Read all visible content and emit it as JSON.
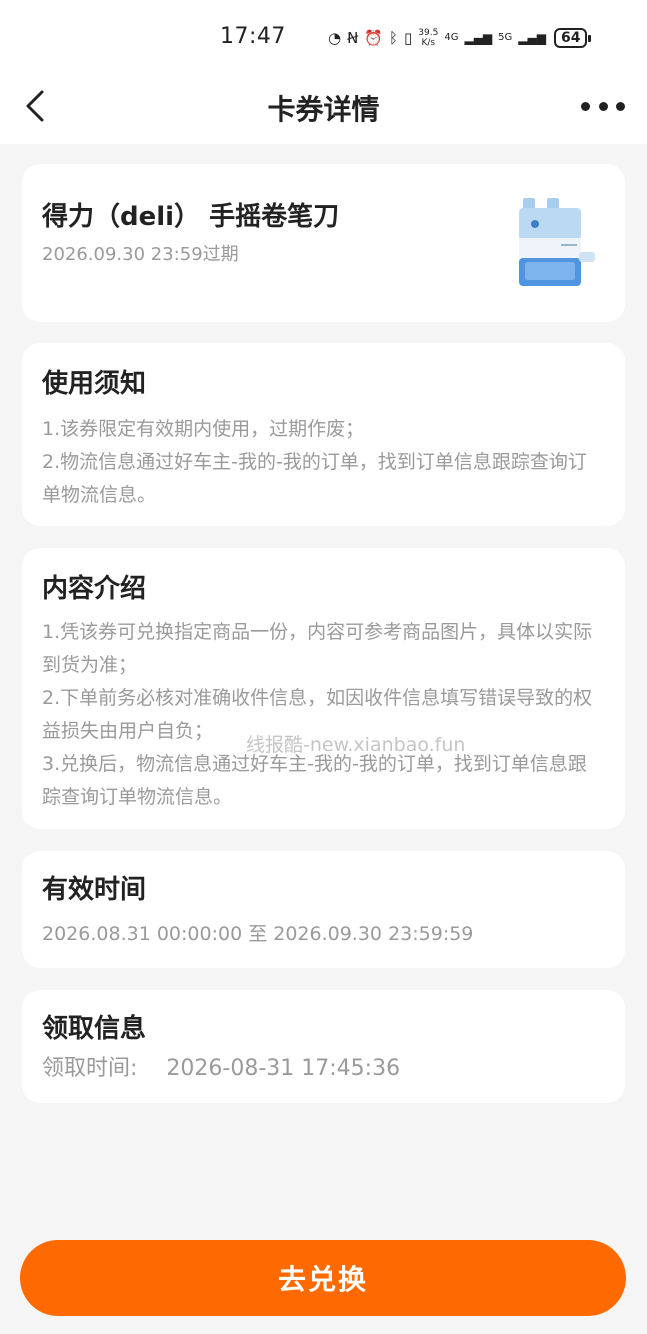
{
  "status_bar": {
    "time": "17:47",
    "net_speed_value": "39.5",
    "net_speed_unit": "K/s",
    "signal_4g": "4G",
    "signal_5g": "5G",
    "battery": "64"
  },
  "nav": {
    "title": "卡券详情"
  },
  "product": {
    "name": "得力（deli） 手摇卷笔刀",
    "expire": "2026.09.30 23:59过期"
  },
  "usage": {
    "title": "使用须知",
    "lines": [
      "1.该券限定有效期内使用，过期作废；",
      "2.物流信息通过好车主-我的-我的订单，找到订单信息跟踪查询订单物流信息。"
    ]
  },
  "content": {
    "title": "内容介绍",
    "lines": [
      "1.凭该券可兑换指定商品一份，内容可参考商品图片，具体以实际到货为准；",
      "2.下单前务必核对准确收件信息，如因收件信息填写错误导致的权益损失由用户自负；",
      "3.兑换后，物流信息通过好车主-我的-我的订单，找到订单信息跟踪查询订单物流信息。"
    ]
  },
  "validity": {
    "title": "有效时间",
    "range": "2026.08.31 00:00:00 至 2026.09.30 23:59:59"
  },
  "receive": {
    "title": "领取信息",
    "label": "领取时间:",
    "time": "2026-08-31 17:45:36"
  },
  "watermark": "线报酷-new.xianbao.fun",
  "action": {
    "redeem_label": "去兑换"
  },
  "colors": {
    "accent": "#ff6a00",
    "background": "#f5f5f5"
  }
}
